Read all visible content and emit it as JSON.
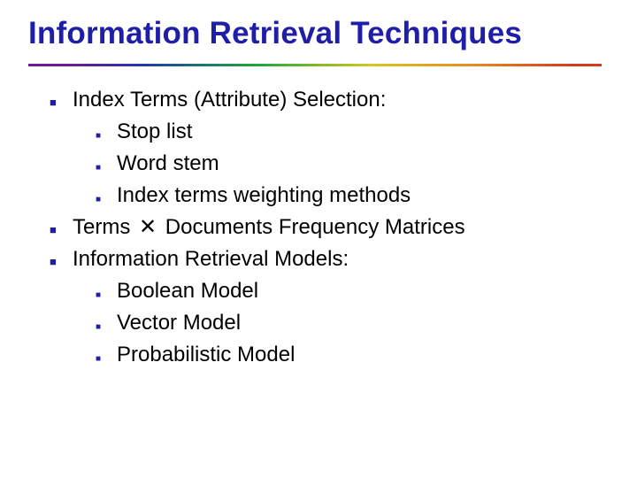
{
  "title": "Information Retrieval Techniques",
  "items": [
    {
      "text": "Index Terms (Attribute) Selection:",
      "sub": [
        {
          "text": "Stop list"
        },
        {
          "text": "Word stem"
        },
        {
          "text": "Index terms weighting methods"
        }
      ]
    },
    {
      "text_pre": "Terms ",
      "operator": "✕",
      "text_post": " Documents Frequency Matrices"
    },
    {
      "text": "Information Retrieval Models:",
      "sub": [
        {
          "text": "Boolean Model"
        },
        {
          "text": "Vector Model"
        },
        {
          "text": "Probabilistic Model"
        }
      ]
    }
  ]
}
